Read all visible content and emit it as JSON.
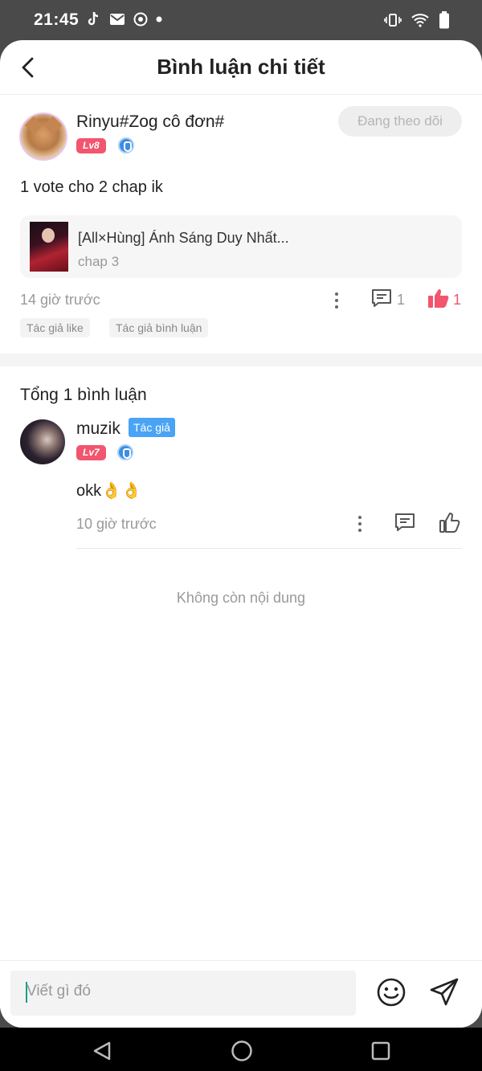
{
  "status_bar": {
    "time": "21:45"
  },
  "header": {
    "title": "Bình luận chi tiết"
  },
  "post": {
    "username": "Rinyu#Zog cô đơn#",
    "level": "Lv8",
    "follow_label": "Đang theo dõi",
    "content": "1 vote cho 2 chap ik",
    "book": {
      "title": "[All×Hùng] Ánh Sáng Duy Nhất...",
      "chapter": "chap 3"
    },
    "time": "14 giờ trước",
    "comment_count": "1",
    "like_count": "1",
    "tags": [
      "Tác giả like",
      "Tác giả bình luận"
    ]
  },
  "replies_section": {
    "total_label": "Tổng 1 bình luận"
  },
  "reply": {
    "username": "muzik",
    "author_badge": "Tác giả",
    "level": "Lv7",
    "content": "okk👌👌",
    "time": "10 giờ trước"
  },
  "end_label": "Không còn nội dung",
  "composer": {
    "placeholder": "Viết gì đó"
  },
  "colors": {
    "accent_pink": "#f2556e",
    "author_blue": "#4aa3f5",
    "muted_text": "#999999"
  }
}
